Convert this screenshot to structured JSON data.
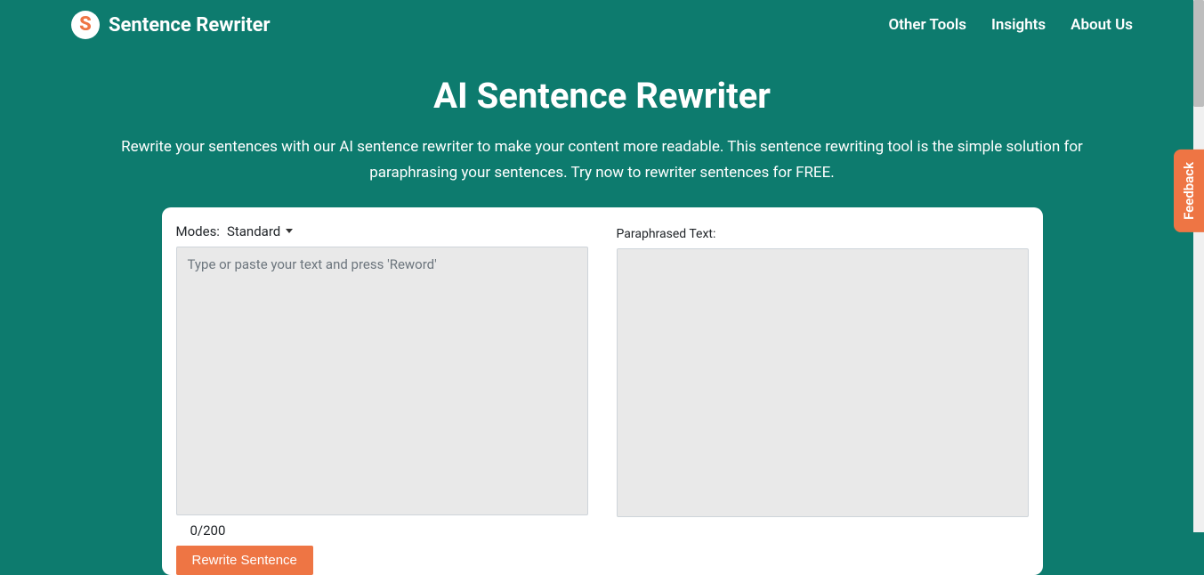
{
  "brand": "Sentence Rewriter",
  "logo_letter": "S",
  "nav": {
    "other_tools": "Other Tools",
    "insights": "Insights",
    "about": "About Us"
  },
  "hero": {
    "title": "AI Sentence Rewriter",
    "subtitle": "Rewrite your sentences with our AI sentence rewriter to make your content more readable. This sentence rewriting tool is the simple solution for paraphrasing your sentences. Try now to rewriter sentences for FREE."
  },
  "tool": {
    "modes_label": "Modes:",
    "mode_selected": "Standard",
    "input_placeholder": "Type or paste your text and press 'Reword'",
    "counter": "0/200",
    "submit_label": "Rewrite Sentence",
    "output_label": "Paraphrased Text:"
  },
  "feedback": "Feedback"
}
